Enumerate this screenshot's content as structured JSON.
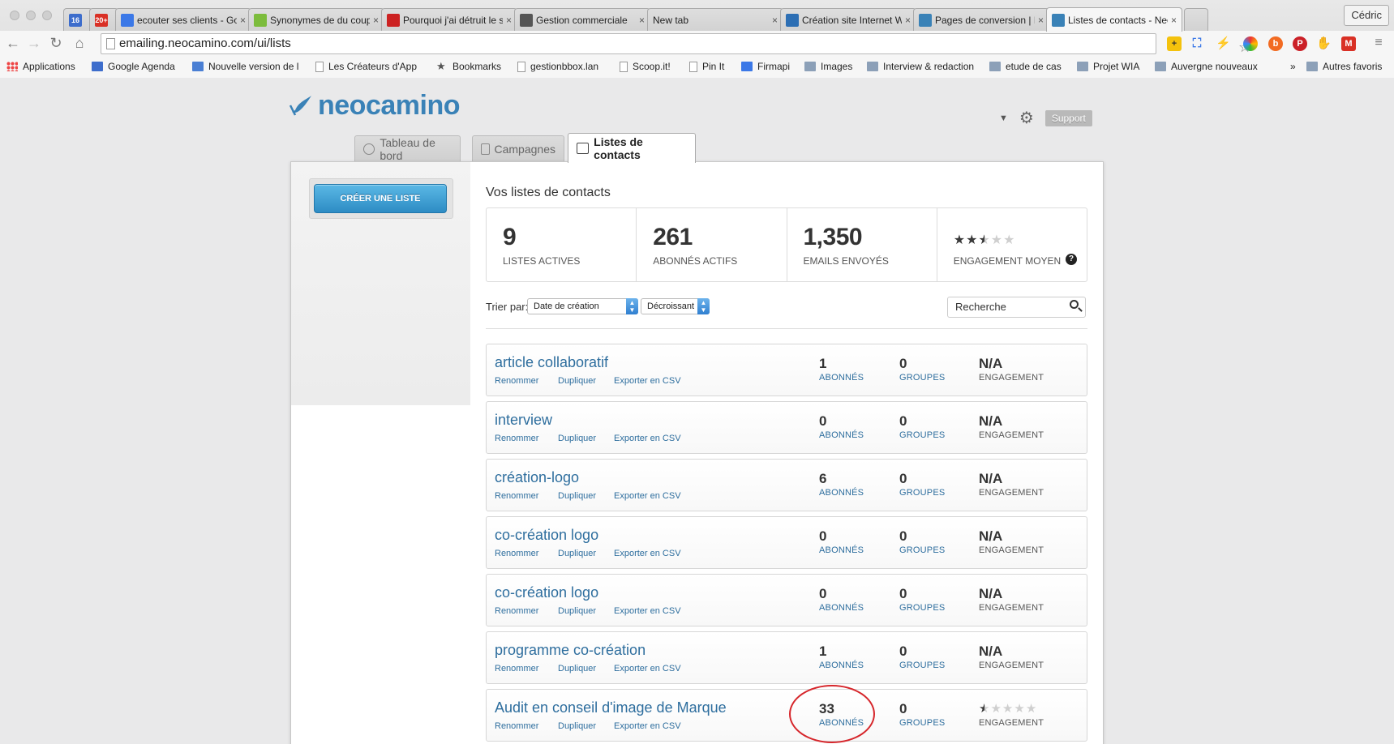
{
  "browser": {
    "tabs": [
      {
        "title": "",
        "icon": "calendar-icon",
        "color": "#3d6dcc",
        "badge": "16"
      },
      {
        "title": "",
        "icon": "gmail-icon",
        "color": "#d93025",
        "badge": "20+"
      },
      {
        "title": "ecouter ses clients - Goog",
        "icon": "docs-icon",
        "color": "#3b78e7"
      },
      {
        "title": "Synonymes de du coup",
        "icon": "ok-icon",
        "color": "#7cbc3c"
      },
      {
        "title": "Pourquoi j'ai détruit le site",
        "icon": "wp-icon",
        "color": "#c22"
      },
      {
        "title": "Gestion commerciale",
        "icon": "people-icon",
        "color": "#555"
      },
      {
        "title": "New tab",
        "icon": "",
        "color": ""
      },
      {
        "title": "Création site Internet Wor",
        "icon": "n-icon",
        "color": "#2d6fb4"
      },
      {
        "title": "Pages de conversion | Neo",
        "icon": "neo-icon",
        "color": "#3a82b7"
      },
      {
        "title": "Listes de contacts - Neoca",
        "icon": "check-icon",
        "color": "#3a82b7",
        "active": true
      }
    ],
    "profile": "Cédric",
    "url": "emailing.neocamino.com/ui/lists",
    "bookmarks": [
      {
        "label": "Applications",
        "icon": "grid"
      },
      {
        "label": "Google Agenda",
        "icon": "cal"
      },
      {
        "label": "Nouvelle version de l",
        "icon": "user"
      },
      {
        "label": "Les Créateurs d'App",
        "icon": "page"
      },
      {
        "label": "Bookmarks",
        "icon": "star"
      },
      {
        "label": "gestionbbox.lan",
        "icon": "page"
      },
      {
        "label": "Scoop.it!",
        "icon": "page"
      },
      {
        "label": "Pin It",
        "icon": "page"
      },
      {
        "label": "Firmapi",
        "icon": "bars"
      },
      {
        "label": "Images",
        "icon": "folder"
      },
      {
        "label": "Interview & redaction",
        "icon": "folder"
      },
      {
        "label": "etude de cas",
        "icon": "folder"
      },
      {
        "label": "Projet WIA",
        "icon": "folder"
      },
      {
        "label": "Auvergne nouveaux",
        "icon": "folder"
      },
      {
        "label": "Autres favoris",
        "icon": "folder"
      }
    ],
    "bookmarks_more": "»"
  },
  "header": {
    "logo": "neocamino",
    "support": "Support"
  },
  "nav": {
    "tabs": [
      "Tableau de bord",
      "Campagnes",
      "Listes de contacts"
    ]
  },
  "sidebar": {
    "create_button": "CRÉER UNE LISTE"
  },
  "main": {
    "title": "Vos listes de contacts",
    "stats": [
      {
        "value": "9",
        "label": "LISTES ACTIVES"
      },
      {
        "value": "261",
        "label": "ABONNÉS ACTIFS"
      },
      {
        "value": "1,350",
        "label": "EMAILS ENVOYÉS"
      },
      {
        "rating": 2.5,
        "label": "ENGAGEMENT MOYEN"
      }
    ],
    "sort_label": "Trier par:",
    "sort_field": "Date de création",
    "sort_order": "Décroissant",
    "search_placeholder": "Recherche",
    "row_actions": [
      "Renommer",
      "Dupliquer",
      "Exporter en CSV"
    ],
    "col_labels": {
      "subscribers": "ABONNÉS",
      "groups": "GROUPES",
      "engagement": "ENGAGEMENT"
    },
    "lists": [
      {
        "name": "article collaboratif",
        "subscribers": "1",
        "groups": "0",
        "engagement": "N/A"
      },
      {
        "name": "interview",
        "subscribers": "0",
        "groups": "0",
        "engagement": "N/A"
      },
      {
        "name": "création-logo",
        "subscribers": "6",
        "groups": "0",
        "engagement": "N/A"
      },
      {
        "name": "co-création logo",
        "subscribers": "0",
        "groups": "0",
        "engagement": "N/A"
      },
      {
        "name": "co-création logo",
        "subscribers": "0",
        "groups": "0",
        "engagement": "N/A"
      },
      {
        "name": "programme co-création",
        "subscribers": "1",
        "groups": "0",
        "engagement": "N/A"
      },
      {
        "name": "Audit en conseil d'image de Marque",
        "subscribers": "33",
        "groups": "0",
        "engagement_rating": 0.5,
        "highlighted": true
      }
    ]
  },
  "colors": {
    "accent": "#3a82b7",
    "link": "#2e6e9e",
    "button": "#2d8cc4",
    "highlight": "#d6262b"
  }
}
